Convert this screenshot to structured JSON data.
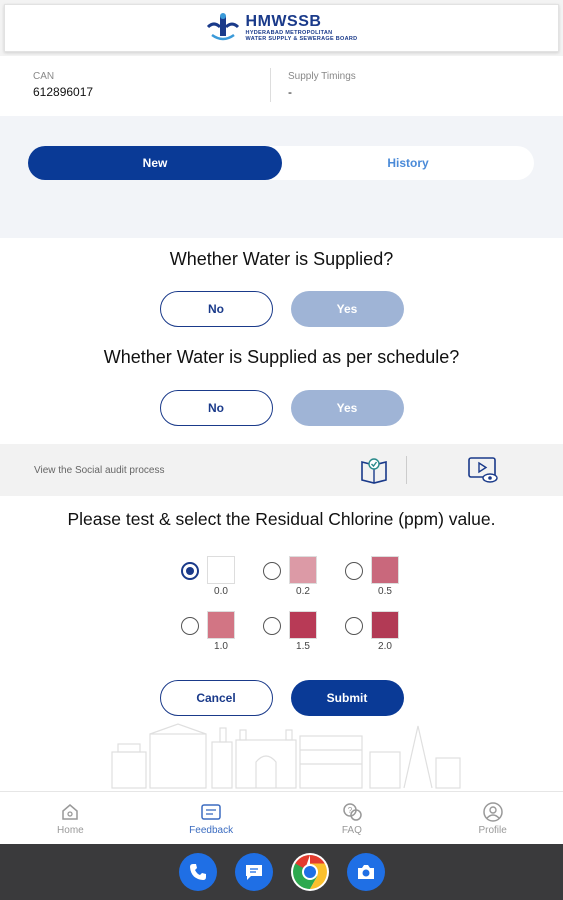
{
  "header": {
    "logo_title": "HMWSSB",
    "logo_subtitle_line1": "HYDERABAD METROPOLITAN",
    "logo_subtitle_line2": "WATER SUPPLY & SEWERAGE BOARD"
  },
  "info": {
    "can_label": "CAN",
    "can_value": "612896017",
    "timings_label": "Supply Timings",
    "timings_value": "-"
  },
  "tabs": {
    "new_label": "New",
    "history_label": "History",
    "active": "New"
  },
  "question1": {
    "text": "Whether Water is Supplied?",
    "no_label": "No",
    "yes_label": "Yes"
  },
  "question2": {
    "text": "Whether Water is Supplied as per schedule?",
    "no_label": "No",
    "yes_label": "Yes"
  },
  "audit": {
    "text": "View the Social audit process"
  },
  "chlorine": {
    "title": "Please test & select the Residual Chlorine (ppm) value.",
    "selected": "0.0",
    "options": [
      {
        "label": "0.0",
        "color": "#ffffff"
      },
      {
        "label": "0.2",
        "color": "#dc9aa6"
      },
      {
        "label": "0.5",
        "color": "#c9687c"
      },
      {
        "label": "1.0",
        "color": "#d27584"
      },
      {
        "label": "1.5",
        "color": "#b83a56"
      },
      {
        "label": "2.0",
        "color": "#b23a55"
      }
    ]
  },
  "actions": {
    "cancel_label": "Cancel",
    "submit_label": "Submit"
  },
  "nav": {
    "items": [
      {
        "label": "Home",
        "icon": "home-icon"
      },
      {
        "label": "Feedback",
        "icon": "feedback-icon"
      },
      {
        "label": "FAQ",
        "icon": "faq-icon"
      },
      {
        "label": "Profile",
        "icon": "profile-icon"
      }
    ],
    "active": "Feedback"
  },
  "dock": {
    "apps": [
      "phone-icon",
      "messages-icon",
      "chrome-icon",
      "camera-icon"
    ]
  },
  "colors": {
    "primary": "#0a3a96",
    "muted_button": "#9fb4d6",
    "accent_link": "#4a8ad8"
  }
}
